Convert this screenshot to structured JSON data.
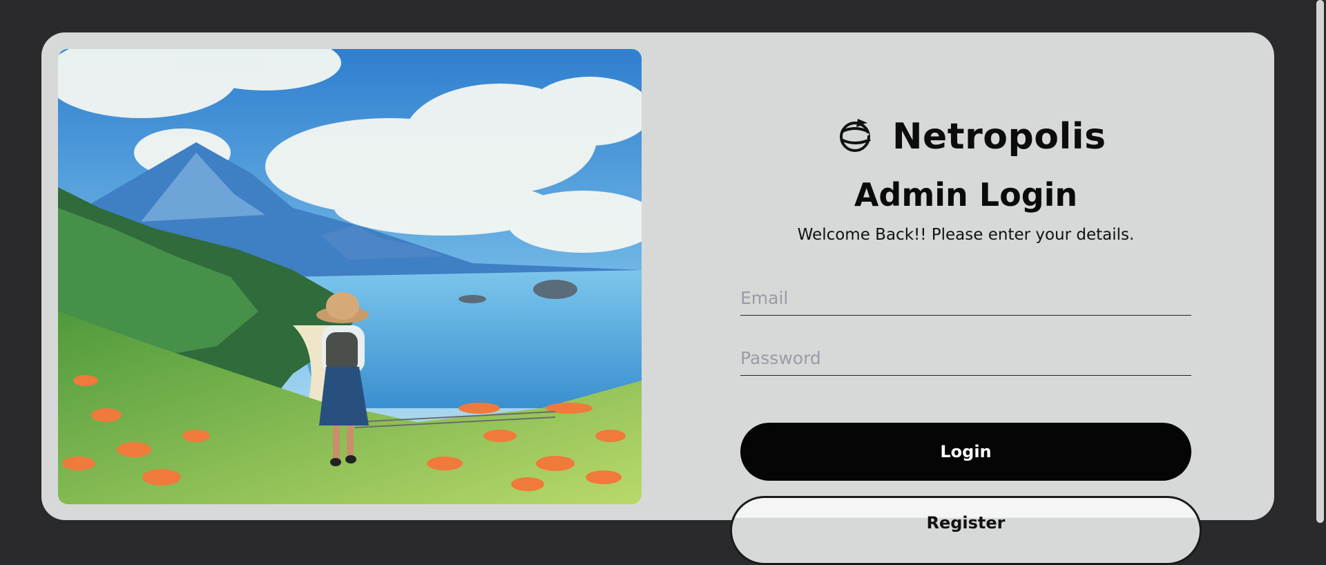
{
  "brand": {
    "name": "Netropolis",
    "logo_icon": "globe-plane-icon"
  },
  "form": {
    "title": "Admin Login",
    "subtitle": "Welcome Back!! Please enter your details.",
    "email_placeholder": "Email",
    "password_placeholder": "Password",
    "login_label": "Login",
    "register_label": "Register"
  },
  "colors": {
    "page_background": "#2a2a2c",
    "card_background": "#d6d9d8",
    "primary_button": "#050505"
  }
}
